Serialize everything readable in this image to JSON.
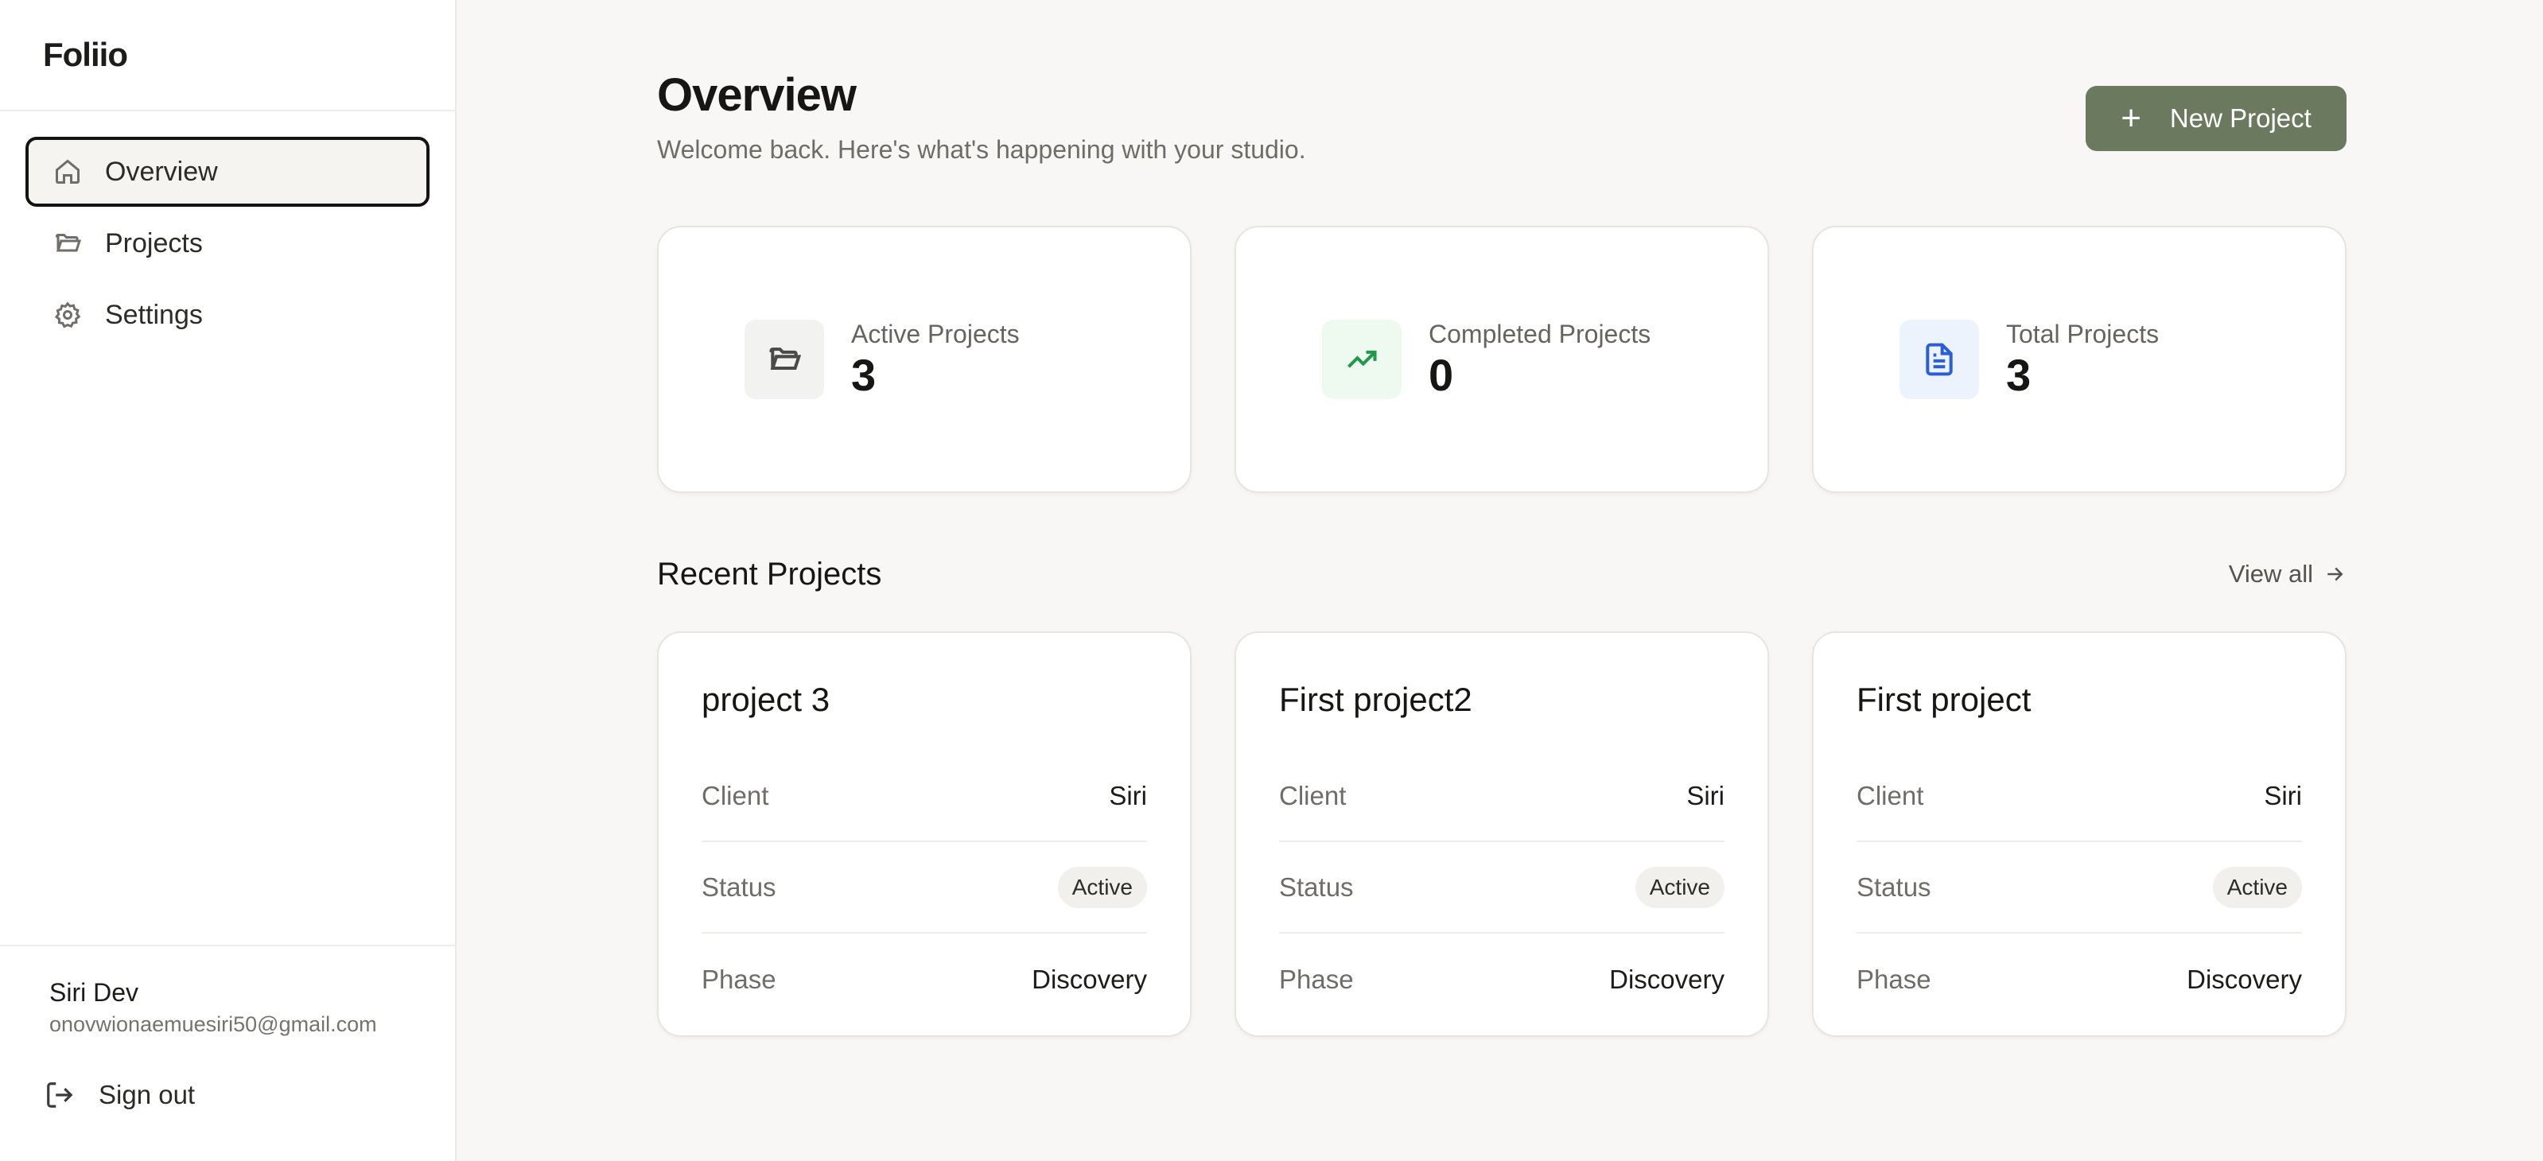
{
  "brand": "Foliio",
  "nav": [
    {
      "label": "Overview",
      "icon": "home-icon",
      "active": true
    },
    {
      "label": "Projects",
      "icon": "folder-icon",
      "active": false
    },
    {
      "label": "Settings",
      "icon": "gear-icon",
      "active": false
    }
  ],
  "user": {
    "name": "Siri Dev",
    "email": "onovwionaemuesiri50@gmail.com",
    "signout_label": "Sign out"
  },
  "header": {
    "title": "Overview",
    "subtitle": "Welcome back. Here's what's happening with your studio.",
    "new_project_label": "New Project"
  },
  "stats": [
    {
      "label": "Active Projects",
      "value": "3",
      "icon": "folder-open-icon",
      "icon_bg": "#f2f2f0",
      "icon_color": "#4a4a46"
    },
    {
      "label": "Completed Projects",
      "value": "0",
      "icon": "trending-up-icon",
      "icon_bg": "#eefaf0",
      "icon_color": "#1e9a4a"
    },
    {
      "label": "Total Projects",
      "value": "3",
      "icon": "document-icon",
      "icon_bg": "#edf3fd",
      "icon_color": "#2a5fd6"
    }
  ],
  "recent": {
    "title": "Recent Projects",
    "view_all_label": "View all",
    "fields": {
      "client": "Client",
      "status": "Status",
      "phase": "Phase"
    },
    "projects": [
      {
        "name": "project 3",
        "client": "Siri",
        "status": "Active",
        "phase": "Discovery"
      },
      {
        "name": "First project2",
        "client": "Siri",
        "status": "Active",
        "phase": "Discovery"
      },
      {
        "name": "First project",
        "client": "Siri",
        "status": "Active",
        "phase": "Discovery"
      }
    ]
  },
  "colors": {
    "accent": "#6b7a5e",
    "background": "#f8f7f5"
  }
}
